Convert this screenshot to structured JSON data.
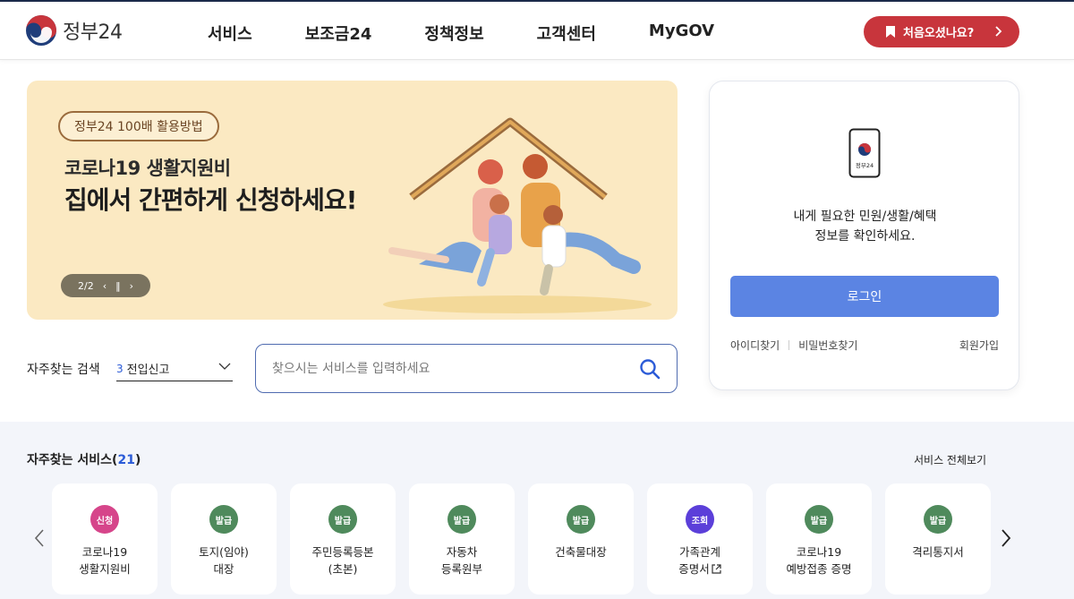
{
  "header": {
    "logo_text": "정부24",
    "nav": [
      "서비스",
      "보조금24",
      "정책정보",
      "고객센터",
      "MyGOV"
    ],
    "first_visit_label": "처음오셨나요?"
  },
  "banner": {
    "tag": "정부24 100배 활용방법",
    "line1": "코로나19 생활지원비",
    "line2": "집에서 간편하게 신청하세요!",
    "pager": "2/2",
    "bg_color": "#fbe9c2"
  },
  "search": {
    "label": "자주찾는 검색",
    "select_num": "3",
    "select_value": "전입신고",
    "placeholder": "찾으시는 서비스를 입력하세요"
  },
  "login": {
    "phone_caption": "정부24",
    "message_line1": "내게 필요한 민원/생활/혜택",
    "message_line2": "정보를 확인하세요.",
    "button": "로그인",
    "find_id": "아이디찾기",
    "find_pw": "비밀번호찾기",
    "join": "회원가입",
    "button_color": "#5b84e3"
  },
  "services": {
    "title": "자주찾는 서비스",
    "count": "21",
    "view_all": "서비스 전체보기",
    "items": [
      {
        "badge": "신청",
        "color": "#d6458a",
        "line1": "코로나19",
        "line2": "생활지원비"
      },
      {
        "badge": "발급",
        "color": "#4f8a5c",
        "line1": "토지(임야)",
        "line2": "대장"
      },
      {
        "badge": "발급",
        "color": "#4f8a5c",
        "line1": "주민등록등본",
        "line2": "(초본)"
      },
      {
        "badge": "발급",
        "color": "#4f8a5c",
        "line1": "자동차",
        "line2": "등록원부"
      },
      {
        "badge": "발급",
        "color": "#4f8a5c",
        "line1": "건축물대장",
        "line2": ""
      },
      {
        "badge": "조회",
        "color": "#5b3fd9",
        "line1": "가족관계",
        "line2": "증명서"
      },
      {
        "badge": "발급",
        "color": "#4f8a5c",
        "line1": "코로나19",
        "line2": "예방접종 증명"
      },
      {
        "badge": "발급",
        "color": "#4f8a5c",
        "line1": "격리통지서",
        "line2": ""
      }
    ]
  }
}
